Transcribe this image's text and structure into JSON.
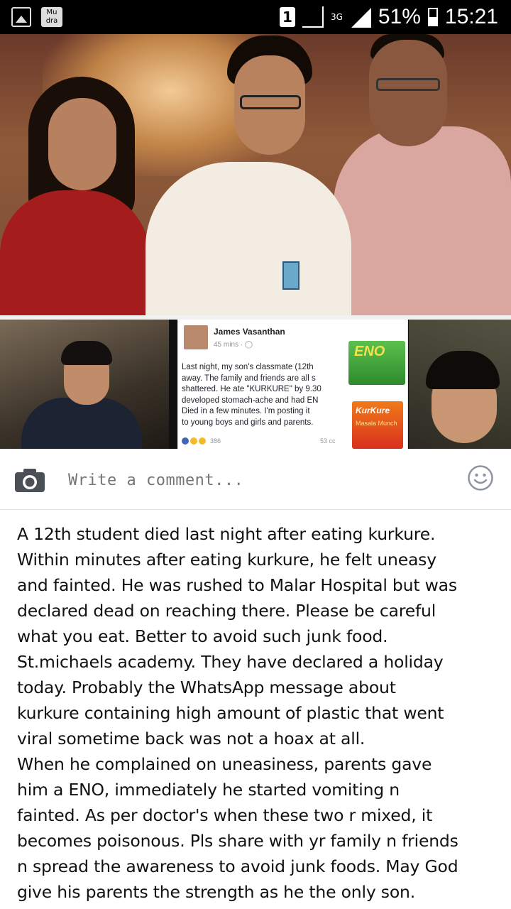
{
  "status_bar": {
    "sim_number": "1",
    "network_type": "3G",
    "battery_percent": "51%",
    "time": "15:21",
    "icons": [
      "gallery-icon",
      "mu-app-icon",
      "signal-icon",
      "battery-icon"
    ]
  },
  "collage": {
    "facebook_post": {
      "author": "James Vasanthan",
      "timestamp": "45 mins · ",
      "body_lines": [
        "Last night, my son's classmate (12th",
        "away. The family and friends are all s",
        "shattered. He ate \"KURKURE\" by 9.30",
        "developed stomach-ache and had EN",
        "Died in a few minutes. I'm posting it",
        "to young boys and girls and parents."
      ],
      "reaction_count": "386",
      "comments_count": "53 cc"
    },
    "eno_brand": "ENO",
    "kurkure_brand": "KurKure",
    "kurkure_flavor": "Masala Munch"
  },
  "comment_bar": {
    "placeholder": "Write a comment..."
  },
  "message": {
    "paragraph_1": "A 12th student died last night after eating kurkure.\nWithin minutes after eating kurkure, he felt uneasy\nand fainted. He was rushed to Malar Hospital but was\ndeclared dead on reaching there. Please be careful\nwhat you eat. Better to avoid such junk food.\nSt.michaels academy. They have declared a holiday\ntoday. Probably the WhatsApp message about\nkurkure containing high amount of plastic that went\nviral sometime back was not a hoax at all.",
    "paragraph_2": " When he complained on uneasiness, parents gave\nhim a ENO, immediately he started vomiting n\nfainted. As per doctor's when these two r mixed, it\nbecomes poisonous. Pls share with yr family n friends\nn spread the awareness to avoid junk foods. May God\ngive his parents the strength as he the only son."
  }
}
